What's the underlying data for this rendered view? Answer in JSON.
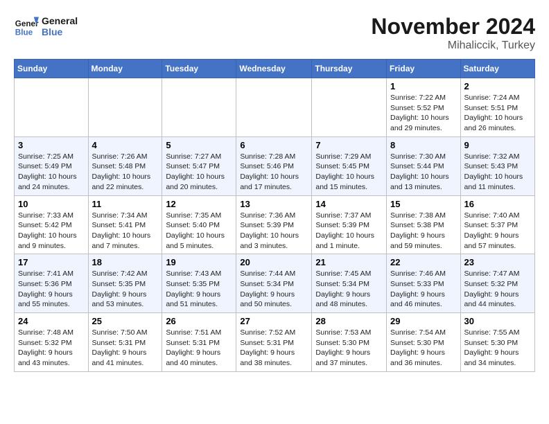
{
  "header": {
    "logo_general": "General",
    "logo_blue": "Blue",
    "month": "November 2024",
    "location": "Mihaliccik, Turkey"
  },
  "days_of_week": [
    "Sunday",
    "Monday",
    "Tuesday",
    "Wednesday",
    "Thursday",
    "Friday",
    "Saturday"
  ],
  "weeks": [
    [
      {
        "day": "",
        "sunrise": "",
        "sunset": "",
        "daylight": ""
      },
      {
        "day": "",
        "sunrise": "",
        "sunset": "",
        "daylight": ""
      },
      {
        "day": "",
        "sunrise": "",
        "sunset": "",
        "daylight": ""
      },
      {
        "day": "",
        "sunrise": "",
        "sunset": "",
        "daylight": ""
      },
      {
        "day": "",
        "sunrise": "",
        "sunset": "",
        "daylight": ""
      },
      {
        "day": "1",
        "sunrise": "Sunrise: 7:22 AM",
        "sunset": "Sunset: 5:52 PM",
        "daylight": "Daylight: 10 hours and 29 minutes."
      },
      {
        "day": "2",
        "sunrise": "Sunrise: 7:24 AM",
        "sunset": "Sunset: 5:51 PM",
        "daylight": "Daylight: 10 hours and 26 minutes."
      }
    ],
    [
      {
        "day": "3",
        "sunrise": "Sunrise: 7:25 AM",
        "sunset": "Sunset: 5:49 PM",
        "daylight": "Daylight: 10 hours and 24 minutes."
      },
      {
        "day": "4",
        "sunrise": "Sunrise: 7:26 AM",
        "sunset": "Sunset: 5:48 PM",
        "daylight": "Daylight: 10 hours and 22 minutes."
      },
      {
        "day": "5",
        "sunrise": "Sunrise: 7:27 AM",
        "sunset": "Sunset: 5:47 PM",
        "daylight": "Daylight: 10 hours and 20 minutes."
      },
      {
        "day": "6",
        "sunrise": "Sunrise: 7:28 AM",
        "sunset": "Sunset: 5:46 PM",
        "daylight": "Daylight: 10 hours and 17 minutes."
      },
      {
        "day": "7",
        "sunrise": "Sunrise: 7:29 AM",
        "sunset": "Sunset: 5:45 PM",
        "daylight": "Daylight: 10 hours and 15 minutes."
      },
      {
        "day": "8",
        "sunrise": "Sunrise: 7:30 AM",
        "sunset": "Sunset: 5:44 PM",
        "daylight": "Daylight: 10 hours and 13 minutes."
      },
      {
        "day": "9",
        "sunrise": "Sunrise: 7:32 AM",
        "sunset": "Sunset: 5:43 PM",
        "daylight": "Daylight: 10 hours and 11 minutes."
      }
    ],
    [
      {
        "day": "10",
        "sunrise": "Sunrise: 7:33 AM",
        "sunset": "Sunset: 5:42 PM",
        "daylight": "Daylight: 10 hours and 9 minutes."
      },
      {
        "day": "11",
        "sunrise": "Sunrise: 7:34 AM",
        "sunset": "Sunset: 5:41 PM",
        "daylight": "Daylight: 10 hours and 7 minutes."
      },
      {
        "day": "12",
        "sunrise": "Sunrise: 7:35 AM",
        "sunset": "Sunset: 5:40 PM",
        "daylight": "Daylight: 10 hours and 5 minutes."
      },
      {
        "day": "13",
        "sunrise": "Sunrise: 7:36 AM",
        "sunset": "Sunset: 5:39 PM",
        "daylight": "Daylight: 10 hours and 3 minutes."
      },
      {
        "day": "14",
        "sunrise": "Sunrise: 7:37 AM",
        "sunset": "Sunset: 5:39 PM",
        "daylight": "Daylight: 10 hours and 1 minute."
      },
      {
        "day": "15",
        "sunrise": "Sunrise: 7:38 AM",
        "sunset": "Sunset: 5:38 PM",
        "daylight": "Daylight: 9 hours and 59 minutes."
      },
      {
        "day": "16",
        "sunrise": "Sunrise: 7:40 AM",
        "sunset": "Sunset: 5:37 PM",
        "daylight": "Daylight: 9 hours and 57 minutes."
      }
    ],
    [
      {
        "day": "17",
        "sunrise": "Sunrise: 7:41 AM",
        "sunset": "Sunset: 5:36 PM",
        "daylight": "Daylight: 9 hours and 55 minutes."
      },
      {
        "day": "18",
        "sunrise": "Sunrise: 7:42 AM",
        "sunset": "Sunset: 5:35 PM",
        "daylight": "Daylight: 9 hours and 53 minutes."
      },
      {
        "day": "19",
        "sunrise": "Sunrise: 7:43 AM",
        "sunset": "Sunset: 5:35 PM",
        "daylight": "Daylight: 9 hours and 51 minutes."
      },
      {
        "day": "20",
        "sunrise": "Sunrise: 7:44 AM",
        "sunset": "Sunset: 5:34 PM",
        "daylight": "Daylight: 9 hours and 50 minutes."
      },
      {
        "day": "21",
        "sunrise": "Sunrise: 7:45 AM",
        "sunset": "Sunset: 5:34 PM",
        "daylight": "Daylight: 9 hours and 48 minutes."
      },
      {
        "day": "22",
        "sunrise": "Sunrise: 7:46 AM",
        "sunset": "Sunset: 5:33 PM",
        "daylight": "Daylight: 9 hours and 46 minutes."
      },
      {
        "day": "23",
        "sunrise": "Sunrise: 7:47 AM",
        "sunset": "Sunset: 5:32 PM",
        "daylight": "Daylight: 9 hours and 44 minutes."
      }
    ],
    [
      {
        "day": "24",
        "sunrise": "Sunrise: 7:48 AM",
        "sunset": "Sunset: 5:32 PM",
        "daylight": "Daylight: 9 hours and 43 minutes."
      },
      {
        "day": "25",
        "sunrise": "Sunrise: 7:50 AM",
        "sunset": "Sunset: 5:31 PM",
        "daylight": "Daylight: 9 hours and 41 minutes."
      },
      {
        "day": "26",
        "sunrise": "Sunrise: 7:51 AM",
        "sunset": "Sunset: 5:31 PM",
        "daylight": "Daylight: 9 hours and 40 minutes."
      },
      {
        "day": "27",
        "sunrise": "Sunrise: 7:52 AM",
        "sunset": "Sunset: 5:31 PM",
        "daylight": "Daylight: 9 hours and 38 minutes."
      },
      {
        "day": "28",
        "sunrise": "Sunrise: 7:53 AM",
        "sunset": "Sunset: 5:30 PM",
        "daylight": "Daylight: 9 hours and 37 minutes."
      },
      {
        "day": "29",
        "sunrise": "Sunrise: 7:54 AM",
        "sunset": "Sunset: 5:30 PM",
        "daylight": "Daylight: 9 hours and 36 minutes."
      },
      {
        "day": "30",
        "sunrise": "Sunrise: 7:55 AM",
        "sunset": "Sunset: 5:30 PM",
        "daylight": "Daylight: 9 hours and 34 minutes."
      }
    ]
  ]
}
